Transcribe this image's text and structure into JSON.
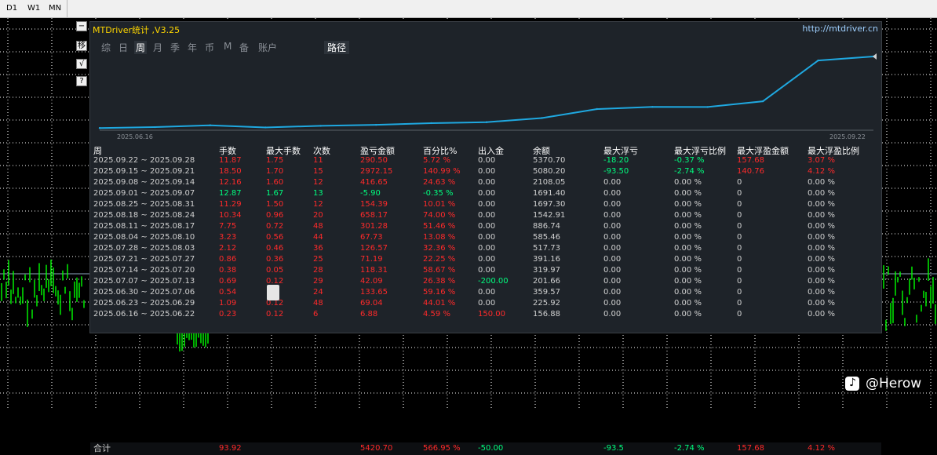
{
  "timeframes": [
    "D1",
    "W1",
    "MN"
  ],
  "side_buttons": [
    "−",
    "移",
    "√",
    "?"
  ],
  "panel": {
    "title": "MTDriver统计 ,V3.25",
    "link": "http://mtdriver.cn",
    "tabs": [
      "综",
      "日",
      "周",
      "月",
      "季",
      "年",
      "币",
      "M",
      "备",
      "账户"
    ],
    "active_tab": "周",
    "path_tab": "路径"
  },
  "chart_data": {
    "type": "line",
    "x": [
      "2025.06.16",
      "2025.06.23",
      "2025.06.30",
      "2025.07.07",
      "2025.07.14",
      "2025.07.21",
      "2025.07.28",
      "2025.08.04",
      "2025.08.11",
      "2025.08.18",
      "2025.08.25",
      "2025.09.01",
      "2025.09.08",
      "2025.09.15",
      "2025.09.22"
    ],
    "y": [
      156.88,
      225.92,
      359.57,
      201.66,
      319.97,
      391.16,
      517.73,
      585.46,
      886.74,
      1542.91,
      1697.3,
      1691.4,
      2108.05,
      5080.2,
      5370.7
    ],
    "x_start_label": "2025.06.16",
    "x_end_label": "2025.09.22",
    "line_color": "#1fa8e0"
  },
  "table": {
    "headers": [
      "周",
      "手数",
      "最大手数",
      "次数",
      "盈亏金额",
      "百分比%",
      "出入金",
      "余额",
      "最大浮亏",
      "最大浮亏比例",
      "最大浮盈金额",
      "最大浮盈比例"
    ],
    "rows": [
      [
        "2025.09.22 ~ 2025.09.28",
        "11.87",
        "1.75",
        "11",
        "290.50",
        "5.72 %",
        "0.00",
        "5370.70",
        "-18.20",
        "-0.37 %",
        "157.68",
        "3.07 %"
      ],
      [
        "2025.09.15 ~ 2025.09.21",
        "18.50",
        "1.70",
        "15",
        "2972.15",
        "140.99 %",
        "0.00",
        "5080.20",
        "-93.50",
        "-2.74 %",
        "140.76",
        "4.12 %"
      ],
      [
        "2025.09.08 ~ 2025.09.14",
        "12.16",
        "1.60",
        "12",
        "416.65",
        "24.63 %",
        "0.00",
        "2108.05",
        "0.00",
        "0.00 %",
        "0",
        "0.00 %"
      ],
      [
        "2025.09.01 ~ 2025.09.07",
        "12.87",
        "1.67",
        "13",
        "-5.90",
        "-0.35 %",
        "0.00",
        "1691.40",
        "0.00",
        "0.00 %",
        "0",
        "0.00 %"
      ],
      [
        "2025.08.25 ~ 2025.08.31",
        "11.29",
        "1.50",
        "12",
        "154.39",
        "10.01 %",
        "0.00",
        "1697.30",
        "0.00",
        "0.00 %",
        "0",
        "0.00 %"
      ],
      [
        "2025.08.18 ~ 2025.08.24",
        "10.34",
        "0.96",
        "20",
        "658.17",
        "74.00 %",
        "0.00",
        "1542.91",
        "0.00",
        "0.00 %",
        "0",
        "0.00 %"
      ],
      [
        "2025.08.11 ~ 2025.08.17",
        "7.75",
        "0.72",
        "48",
        "301.28",
        "51.46 %",
        "0.00",
        "886.74",
        "0.00",
        "0.00 %",
        "0",
        "0.00 %"
      ],
      [
        "2025.08.04 ~ 2025.08.10",
        "3.23",
        "0.56",
        "44",
        "67.73",
        "13.08 %",
        "0.00",
        "585.46",
        "0.00",
        "0.00 %",
        "0",
        "0.00 %"
      ],
      [
        "2025.07.28 ~ 2025.08.03",
        "2.12",
        "0.46",
        "36",
        "126.57",
        "32.36 %",
        "0.00",
        "517.73",
        "0.00",
        "0.00 %",
        "0",
        "0.00 %"
      ],
      [
        "2025.07.21 ~ 2025.07.27",
        "0.86",
        "0.36",
        "25",
        "71.19",
        "22.25 %",
        "0.00",
        "391.16",
        "0.00",
        "0.00 %",
        "0",
        "0.00 %"
      ],
      [
        "2025.07.14 ~ 2025.07.20",
        "0.38",
        "0.05",
        "28",
        "118.31",
        "58.67 %",
        "0.00",
        "319.97",
        "0.00",
        "0.00 %",
        "0",
        "0.00 %"
      ],
      [
        "2025.07.07 ~ 2025.07.13",
        "0.69",
        "0.12",
        "29",
        "42.09",
        "26.38 %",
        "-200.00",
        "201.66",
        "0.00",
        "0.00 %",
        "0",
        "0.00 %"
      ],
      [
        "2025.06.30 ~ 2025.07.06",
        "0.54",
        "",
        "24",
        "133.65",
        "59.16 %",
        "0.00",
        "359.57",
        "0.00",
        "0.00 %",
        "0",
        "0.00 %"
      ],
      [
        "2025.06.23 ~ 2025.06.29",
        "1.09",
        "0.12",
        "48",
        "69.04",
        "44.01 %",
        "0.00",
        "225.92",
        "0.00",
        "0.00 %",
        "0",
        "0.00 %"
      ],
      [
        "2025.06.16 ~ 2025.06.22",
        "0.23",
        "0.12",
        "6",
        "6.88",
        "4.59 %",
        "150.00",
        "156.88",
        "0.00",
        "0.00 %",
        "0",
        "0.00 %"
      ]
    ],
    "total": [
      "合计",
      "93.92",
      "",
      "",
      "5420.70",
      "566.95 %",
      "-50.00",
      "",
      "-93.5",
      "-2.74 %",
      "157.68",
      "4.12 %"
    ]
  },
  "watermark": {
    "icon": "douyin-icon",
    "text": "@Herow"
  },
  "colors": {
    "profit": "#ff2a2a",
    "loss": "#00ff7f",
    "neutral": "#d0d0d0",
    "panel_bg": "#1e2329",
    "title": "#ffd700",
    "link": "#9fd0ff",
    "candles": "#00ff00"
  }
}
